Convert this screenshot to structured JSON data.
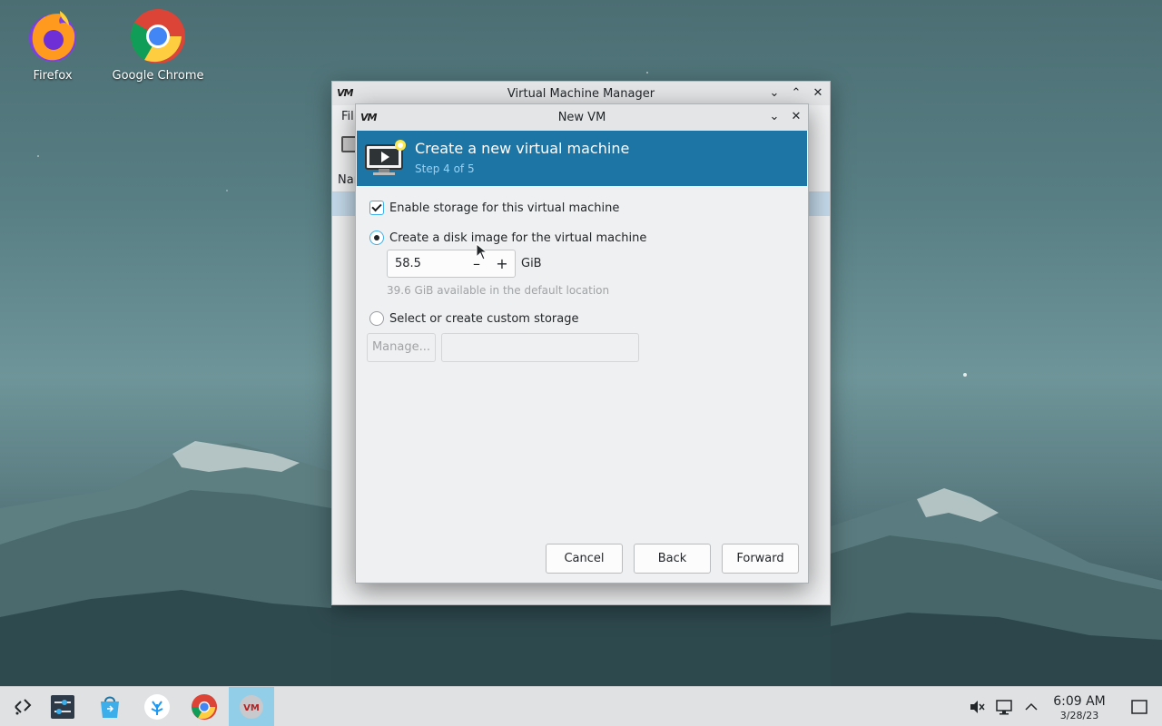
{
  "desktop": {
    "icons": [
      {
        "label": "Firefox"
      },
      {
        "label": "Google Chrome"
      }
    ]
  },
  "vmm_window": {
    "title": "Virtual Machine Manager",
    "menu_partial": "Fil",
    "column_partial": "Nar"
  },
  "dialog": {
    "title": "New VM",
    "header_title": "Create a new virtual machine",
    "header_step": "Step 4 of 5",
    "enable_storage_label": "Enable storage for this virtual machine",
    "enable_storage_checked": true,
    "create_disk_label": "Create a disk image for the virtual machine",
    "disk_size_value": "58.5",
    "disk_size_unit": "GiB",
    "available_note": "39.6 GiB available in the default location",
    "custom_storage_label": "Select or create custom storage",
    "manage_button": "Manage...",
    "cancel_button": "Cancel",
    "back_button": "Back",
    "forward_button": "Forward",
    "header_color": "#1d75a5"
  },
  "taskbar": {
    "items": [
      "application-launcher-icon",
      "system-settings-icon",
      "discover-store-icon",
      "kde-connect-icon",
      "google-chrome-icon",
      "virt-manager-icon"
    ],
    "tray": [
      "volume-muted-icon",
      "network-icon",
      "tray-expand-icon"
    ],
    "clock_time": "6:09 AM",
    "clock_date": "3/28/23",
    "accent": "#93cee9"
  }
}
